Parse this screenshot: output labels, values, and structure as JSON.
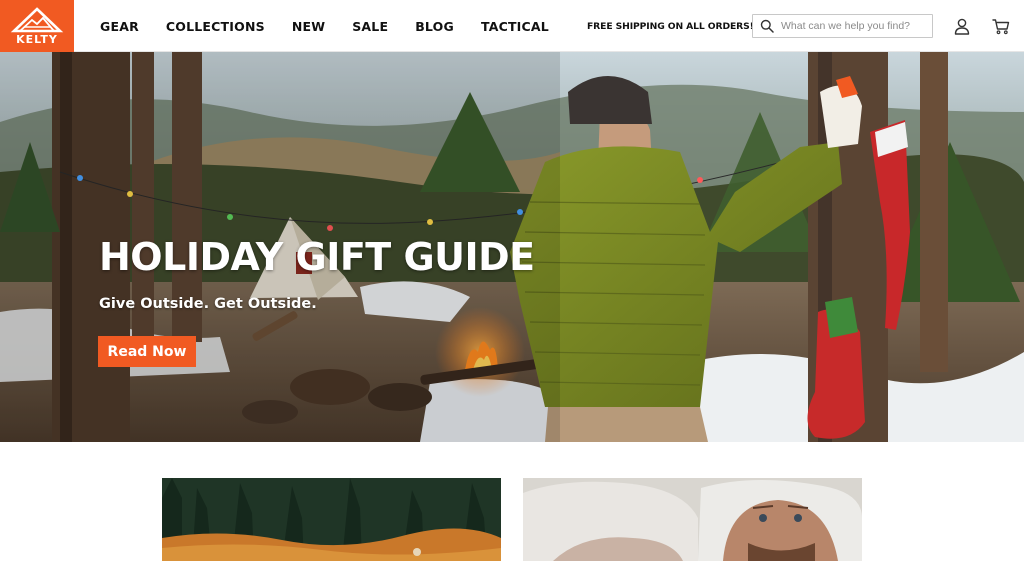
{
  "brand": {
    "logo_text": "KELTY",
    "accent": "#f15a22"
  },
  "nav": {
    "items": [
      {
        "label": "GEAR"
      },
      {
        "label": "COLLECTIONS"
      },
      {
        "label": "NEW"
      },
      {
        "label": "SALE"
      },
      {
        "label": "BLOG"
      },
      {
        "label": "TACTICAL"
      }
    ]
  },
  "header": {
    "shipping_text": "FREE SHIPPING ON ALL ORDERS!*",
    "search_placeholder": "What can we help you find?",
    "icons": [
      "search-icon",
      "account-icon",
      "cart-icon"
    ]
  },
  "hero": {
    "title": "HOLIDAY GIFT GUIDE",
    "subtitle": "Give Outside. Get Outside.",
    "cta_label": "Read Now"
  }
}
